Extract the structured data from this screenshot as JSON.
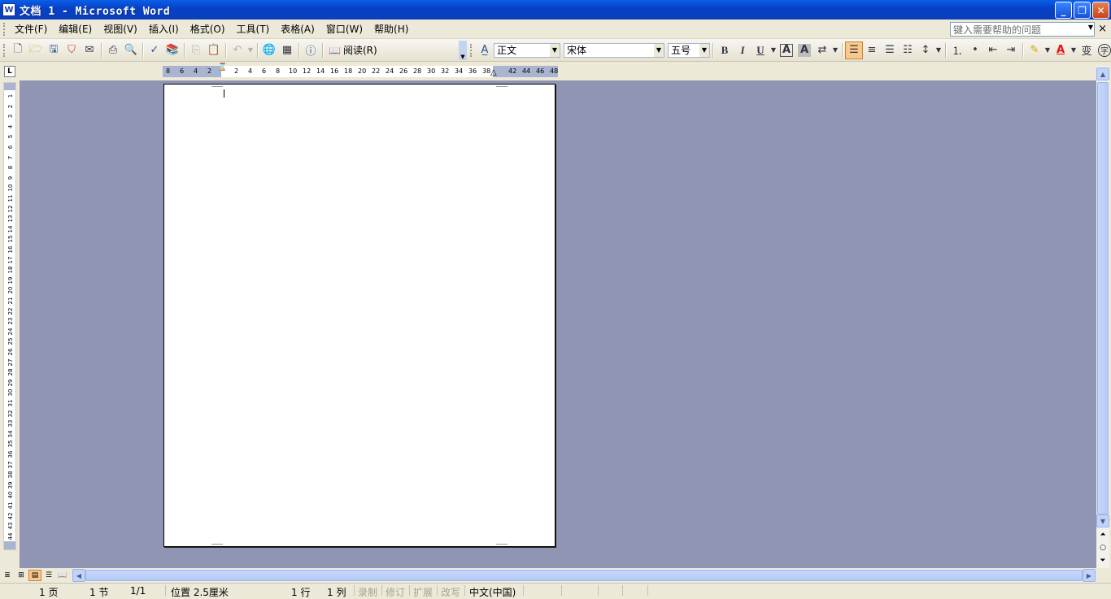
{
  "window": {
    "title": "文档 1 - Microsoft Word",
    "app_icon": "word-doc-icon",
    "controls": {
      "minimize": "_",
      "restore": "❐",
      "close": "✕"
    }
  },
  "menu": {
    "items": [
      "文件(F)",
      "编辑(E)",
      "视图(V)",
      "插入(I)",
      "格式(O)",
      "工具(T)",
      "表格(A)",
      "窗口(W)",
      "帮助(H)"
    ],
    "help_placeholder": "键入需要帮助的问题",
    "close_glyph": "×"
  },
  "toolbar": {
    "read_label": "阅读(R)",
    "style_value": "正文",
    "font_value": "宋体",
    "size_value": "五号",
    "bold": "B",
    "italic": "I",
    "underline": "U",
    "char_border": "A",
    "char_shading": "A",
    "font_color": "A",
    "phonetic": "变",
    "enclose": "字"
  },
  "ruler": {
    "tab_selector": "L",
    "h_labels": [
      "8",
      "6",
      "4",
      "2",
      "2",
      "4",
      "6",
      "8",
      "10",
      "12",
      "14",
      "16",
      "18",
      "20",
      "22",
      "24",
      "26",
      "28",
      "30",
      "32",
      "34",
      "36",
      "38",
      "42",
      "44",
      "46",
      "48"
    ],
    "v_labels": [
      "1",
      "2",
      "3",
      "4",
      "5",
      "6",
      "7",
      "8",
      "9",
      "10",
      "11",
      "12",
      "13",
      "14",
      "15",
      "16",
      "17",
      "18",
      "19",
      "20",
      "21",
      "22",
      "23",
      "24",
      "25",
      "26",
      "27",
      "28",
      "29",
      "30",
      "31",
      "32",
      "33",
      "34",
      "35",
      "36",
      "37",
      "38",
      "39",
      "40",
      "41",
      "42",
      "43",
      "44",
      "45"
    ]
  },
  "status": {
    "page": "1 页",
    "section": "1 节",
    "page_count": "1/1",
    "position": "位置 2.5厘米",
    "line": "1 行",
    "column": "1 列",
    "rec": "录制",
    "trk": "修订",
    "ext": "扩展",
    "ovr": "改写",
    "language": "中文(中国)"
  },
  "colors": {
    "titlebar": "#0a4fd8",
    "workspace": "#8f95b2",
    "highlight": "#f9c98c"
  }
}
